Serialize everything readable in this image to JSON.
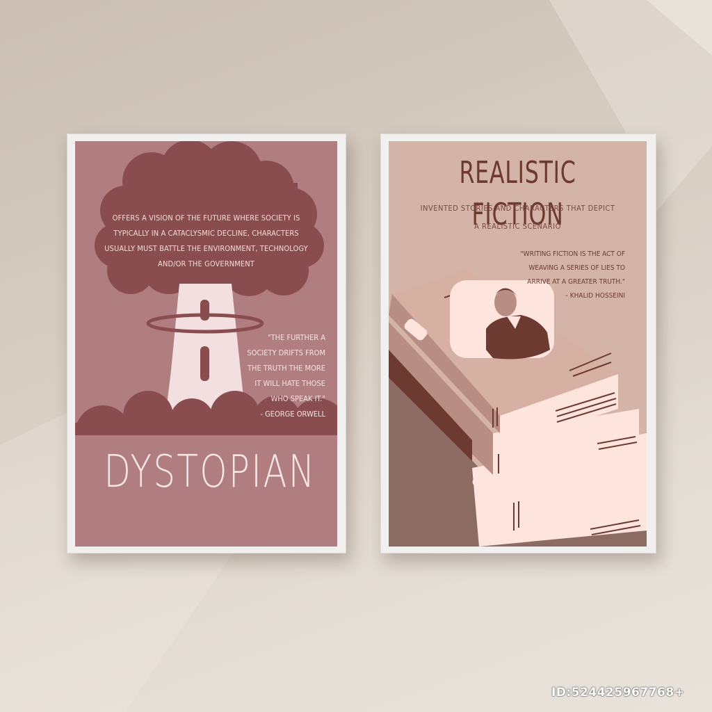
{
  "scene": "two framed posters on a wall",
  "colors": {
    "wall": "#d8cfc5",
    "frame": "#f2f0ee",
    "dystopian_bg": "#b07e80",
    "dystopian_dark": "#8a4d4f",
    "dystopian_light": "#f3dfdf",
    "realistic_bg": "#d4b3a8",
    "realistic_dark": "#6c3a30",
    "book_light": "#fde4dc",
    "book_mid": "#b88d83",
    "book_shade": "#8c6b62"
  },
  "posters": {
    "dystopian": {
      "description": "Offers a vision of the future where society is typically in a cataclysmic decline, characters usually must battle the environment, technology and/or the government",
      "quote": "\"The further a society drifts from the truth the more it will hate those who speak it.\"",
      "quote_author": "- George Orwell",
      "title": "DYSTOPIAN",
      "illustration_icon": "mushroom-cloud-icon"
    },
    "realistic_fiction": {
      "title": "REALISTIC FICTION",
      "subtitle_line1": "Invented stories and characters that depict",
      "subtitle_line2": "a realistic scenario",
      "quote": "\"Writing fiction is the act of weaving a series of lies to arrive at a greater truth.\"",
      "quote_author": "- Khalid Hosseini",
      "illustration_icon": "book-stack-icon",
      "cover_icon": "person-portrait-icon"
    }
  },
  "watermark": "ID:524425967768+"
}
